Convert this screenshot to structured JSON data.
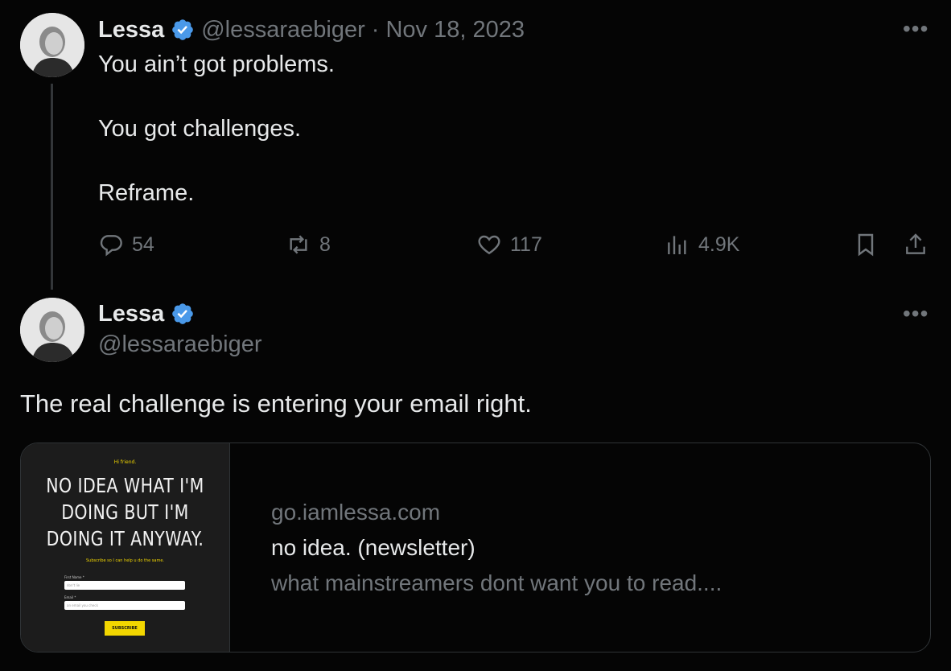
{
  "tweet1": {
    "author_name": "Lessa",
    "handle": "@lessaraebiger",
    "separator": "·",
    "date": "Nov 18, 2023",
    "lines": [
      "You ain’t got problems.",
      "You got challenges.",
      "Reframe."
    ],
    "more_label": "•••",
    "actions": {
      "replies": "54",
      "reposts": "8",
      "likes": "117",
      "views": "4.9K"
    }
  },
  "tweet2": {
    "author_name": "Lessa",
    "handle": "@lessaraebiger",
    "more_label": "•••",
    "text": "The real challenge is entering your email right."
  },
  "link_card": {
    "domain": "go.iamlessa.com",
    "title": "no idea. (newsletter)",
    "description": "what mainstreamers dont want you to read....",
    "thumbnail": {
      "greeting": "Hi friend.",
      "headline_lines": [
        "NO IDEA WHAT I'M",
        "DOING BUT I'M",
        "DOING IT ANYWAY."
      ],
      "subtext": "Subscribe so I can help u do the same.",
      "first_name_label": "First Name *",
      "first_name_placeholder": "don't lie",
      "email_label": "Email *",
      "email_placeholder": "an email you check",
      "button_label": "SUBSCRIBE"
    }
  },
  "colors": {
    "background": "#050505",
    "text": "#e7e9ea",
    "muted": "#71767b",
    "verified": "#4a99e9",
    "thumb_accent": "#f2d600"
  }
}
